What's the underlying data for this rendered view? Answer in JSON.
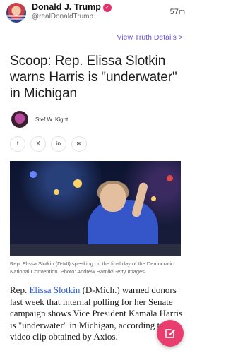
{
  "post": {
    "author_name": "Donald J. Trump",
    "handle": "@realDonaldTrump",
    "time": "57m",
    "view_link": "View Truth Details",
    "view_link_chevron": ">"
  },
  "article": {
    "headline": "Scoop: Rep. Elissa Slotkin warns Harris is \"underwater\" in Michigan",
    "byline": "Stef W. Kight",
    "share_buttons": [
      "f",
      "X",
      "in",
      "✉"
    ],
    "caption": "Rep. Elissa Slotkin (D-MI) speaking on the final day of the Democratic National Convention. Photo: Andrew Harnik/Getty Images",
    "body_prefix": "Rep. ",
    "body_link": "Elissa Slotkin",
    "body_rest": " (D-Mich.) warned donors last week that internal polling for her Senate campaign shows Vice President Kamala Harris is \"underwater\" in Michigan, according to a video clip obtained by Axios."
  },
  "colors": {
    "accent": "#6a56d6",
    "fab": "#ea3d6f",
    "verified": "#e1336b",
    "link": "#2a5bd7"
  },
  "icons": {
    "verified": "verified-badge-icon",
    "fab": "compose-icon"
  }
}
